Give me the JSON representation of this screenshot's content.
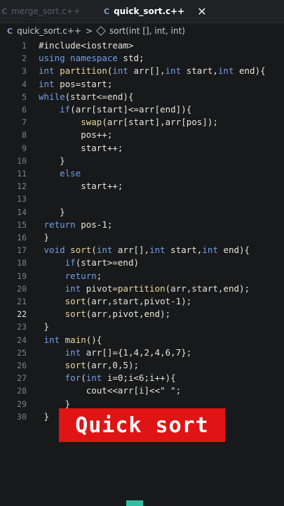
{
  "tabs": [
    {
      "lang": "C",
      "label": "merge_sort.c++",
      "active": false
    },
    {
      "lang": "C",
      "label": "quick_sort.c++",
      "active": true,
      "close": "✕"
    }
  ],
  "breadcrumb": {
    "lang": "C",
    "file": "quick_sort.c++",
    "sep": ">",
    "symbol": "sort(int [], int, int)"
  },
  "lines": [
    {
      "n": "1",
      "text": "#include<iostream>"
    },
    {
      "n": "2",
      "text": "using namespace std;"
    },
    {
      "n": "3",
      "text": "int partition(int arr[],int start,int end){"
    },
    {
      "n": "4",
      "text": "int pos=start;"
    },
    {
      "n": "5",
      "text": "while(start<=end){"
    },
    {
      "n": "6",
      "text": "    if(arr[start]<=arr[end]){"
    },
    {
      "n": "7",
      "text": "        swap(arr[start],arr[pos]);"
    },
    {
      "n": "8",
      "text": "        pos++;"
    },
    {
      "n": "9",
      "text": "        start++;"
    },
    {
      "n": "10",
      "text": "    }"
    },
    {
      "n": "11",
      "text": "    else"
    },
    {
      "n": "12",
      "text": "        start++;"
    },
    {
      "n": "13",
      "text": ""
    },
    {
      "n": "14",
      "text": "    }"
    },
    {
      "n": "15",
      "text": " return pos-1;"
    },
    {
      "n": "16",
      "text": " }"
    },
    {
      "n": "17",
      "text": " void sort(int arr[],int start,int end){"
    },
    {
      "n": "18",
      "text": "     if(start>=end)"
    },
    {
      "n": "19",
      "text": "     return;"
    },
    {
      "n": "20",
      "text": "     int pivot=partition(arr,start,end);"
    },
    {
      "n": "21",
      "text": "     sort(arr,start,pivot-1);"
    },
    {
      "n": "22",
      "text": "     sort(arr,pivot,end);"
    },
    {
      "n": "23",
      "text": " }"
    },
    {
      "n": "24",
      "text": " int main(){"
    },
    {
      "n": "25",
      "text": "     int arr[]={1,4,2,4,6,7};"
    },
    {
      "n": "26",
      "text": "     sort(arr,0,5);"
    },
    {
      "n": "27",
      "text": "     for(int i=0;i<6;i++){"
    },
    {
      "n": "28",
      "text": "         cout<<arr[i]<<\" \";"
    },
    {
      "n": "29",
      "text": "     }"
    },
    {
      "n": "30",
      "text": " }"
    }
  ],
  "current_line": "22",
  "banner": "Quick sort"
}
